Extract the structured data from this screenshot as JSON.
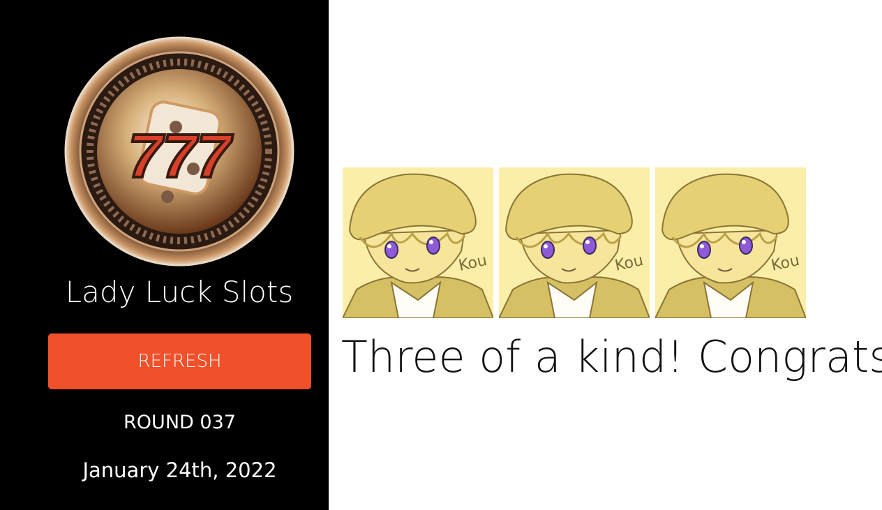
{
  "sidebar": {
    "logo_text": "777",
    "title": "Lady Luck Slots",
    "refresh_label": "REFRESH",
    "round_label": "ROUND 037",
    "date": "January 24th, 2022"
  },
  "reels": [
    {
      "symbol": "character-in-cap",
      "signature": "Kou"
    },
    {
      "symbol": "character-in-cap",
      "signature": "Kou"
    },
    {
      "symbol": "character-in-cap",
      "signature": "Kou"
    }
  ],
  "result": {
    "message": "Three of a kind! Congrats!"
  },
  "colors": {
    "sidebar_bg": "#000000",
    "button_bg": "#f0502a",
    "reel_bg": "#fbeea9"
  }
}
